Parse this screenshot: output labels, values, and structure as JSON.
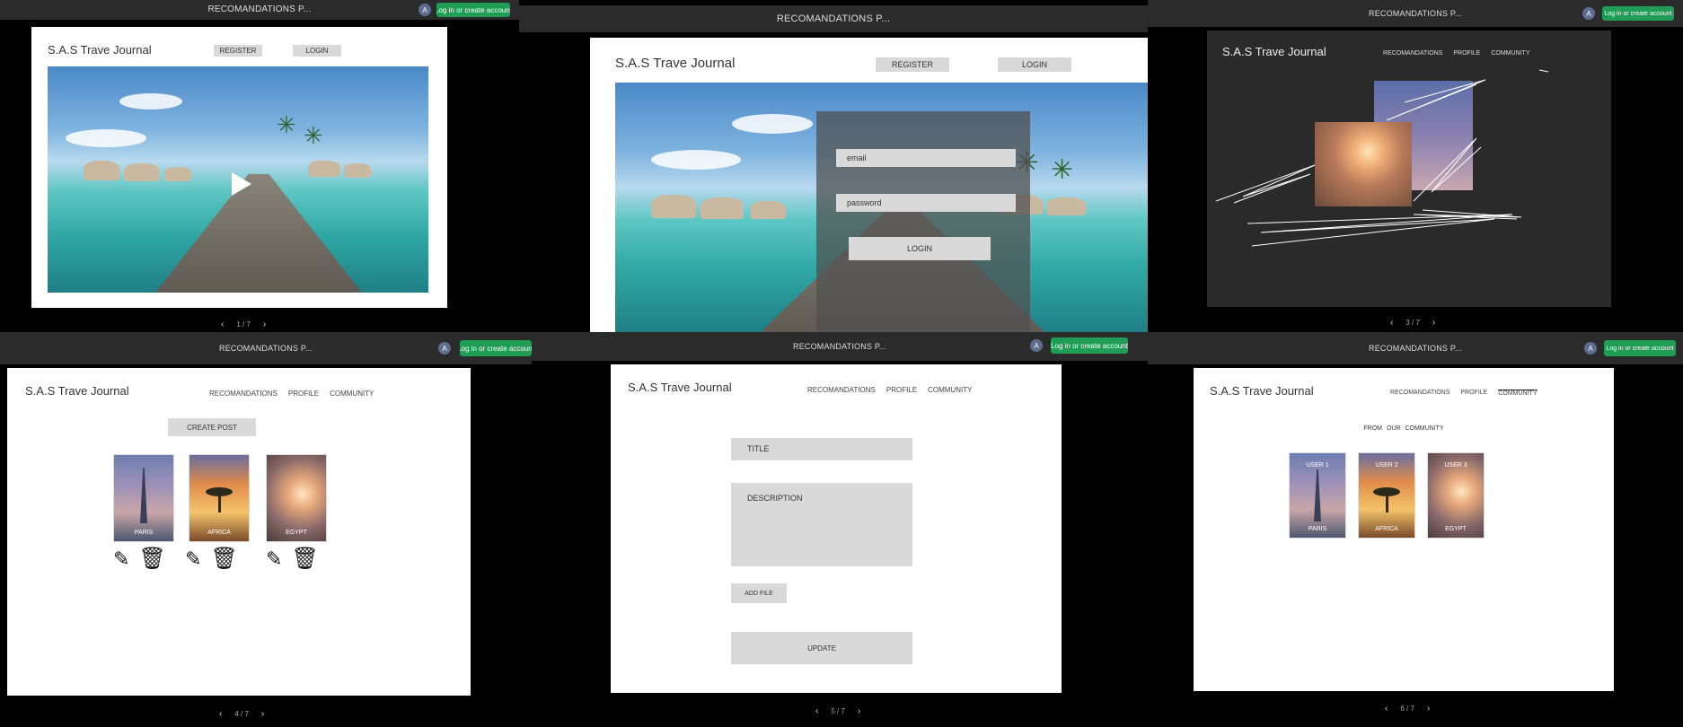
{
  "app": {
    "topbar_title": "RECOMANDATIONS P...",
    "avatar_letter": "A",
    "login_button": "Log in or create account",
    "brand": "S.A.S Trave Journal",
    "accent_color": "#1f9d55"
  },
  "slide1": {
    "nav_register": "REGISTER",
    "nav_login": "LOGIN",
    "pager": "1 / 7"
  },
  "slide2": {
    "nav_register": "REGISTER",
    "nav_login": "LOGIN",
    "email_placeholder": "email",
    "password_placeholder": "password",
    "login_button": "LOGIN"
  },
  "slide3": {
    "nav": [
      "RECOMANDATIONS",
      "PROFILE",
      "COMMUNITY"
    ],
    "pager": "3 / 7"
  },
  "slide4": {
    "nav": [
      "RECOMANDATIONS",
      "PROFILE",
      "COMMUNITY"
    ],
    "create_post": "CREATE POST",
    "cards": [
      "PARIS",
      "AFRICA",
      "EGYPT"
    ],
    "pager": "4 / 7"
  },
  "slide5": {
    "nav": [
      "RECOMANDATIONS",
      "PROFILE",
      "COMMUNITY"
    ],
    "title_field": "TITLE",
    "description_field": "DESCRIPTION",
    "add_file": "ADD FILE",
    "update": "UPDATE",
    "pager": "5 / 7"
  },
  "slide6": {
    "nav": [
      "RECOMANDATIONS",
      "PROFILE",
      "COMMUNITY"
    ],
    "heading": "FROM OUR COMMUNITY",
    "cards": [
      {
        "user": "USER 1",
        "place": "PARIS"
      },
      {
        "user": "USER 2",
        "place": "AFRICA"
      },
      {
        "user": "USER 3",
        "place": "EGYPT"
      }
    ],
    "pager": "6 / 7"
  }
}
